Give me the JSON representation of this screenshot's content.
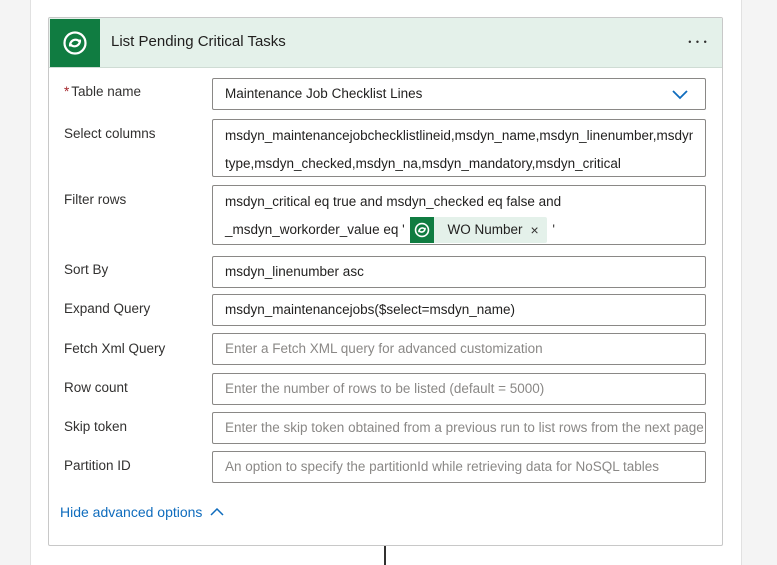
{
  "action": {
    "title": "List Pending Critical Tasks",
    "menu_glyph": "• • •",
    "icon": "dataverse-icon"
  },
  "fields": {
    "table_name": {
      "required_mark": "*",
      "label": "Table name",
      "value": "Maintenance Job Checklist Lines"
    },
    "select_columns": {
      "label": "Select columns",
      "line1": "msdyn_maintenancejobchecklistlineid,msdyn_name,msdyn_linenumber,msdyn_",
      "line2": "type,msdyn_checked,msdyn_na,msdyn_mandatory,msdyn_critical"
    },
    "filter_rows": {
      "label": "Filter rows",
      "line1": "msdyn_critical eq true and msdyn_checked eq false and",
      "line2_prefix": "_msdyn_workorder_value eq '",
      "token_label": "WO Number",
      "token_close": "×",
      "line2_suffix": "'"
    },
    "sort_by": {
      "label": "Sort By",
      "value": "msdyn_linenumber asc"
    },
    "expand_query": {
      "label": "Expand Query",
      "value": "msdyn_maintenancejobs($select=msdyn_name)"
    },
    "fetch_xml": {
      "label": "Fetch Xml Query",
      "placeholder": "Enter a Fetch XML query for advanced customization"
    },
    "row_count": {
      "label": "Row count",
      "placeholder": "Enter the number of rows to be listed (default = 5000)"
    },
    "skip_token": {
      "label": "Skip token",
      "placeholder": "Enter the skip token obtained from a previous run to list rows from the next page"
    },
    "partition_id": {
      "label": "Partition ID",
      "placeholder": "An option to specify the partitionId while retrieving data for NoSQL tables"
    }
  },
  "advanced": {
    "toggle_label": "Hide advanced options"
  },
  "colors": {
    "brand_green": "#107c41",
    "header_bg": "#e4f1ea",
    "link_blue": "#0f6cbd"
  }
}
